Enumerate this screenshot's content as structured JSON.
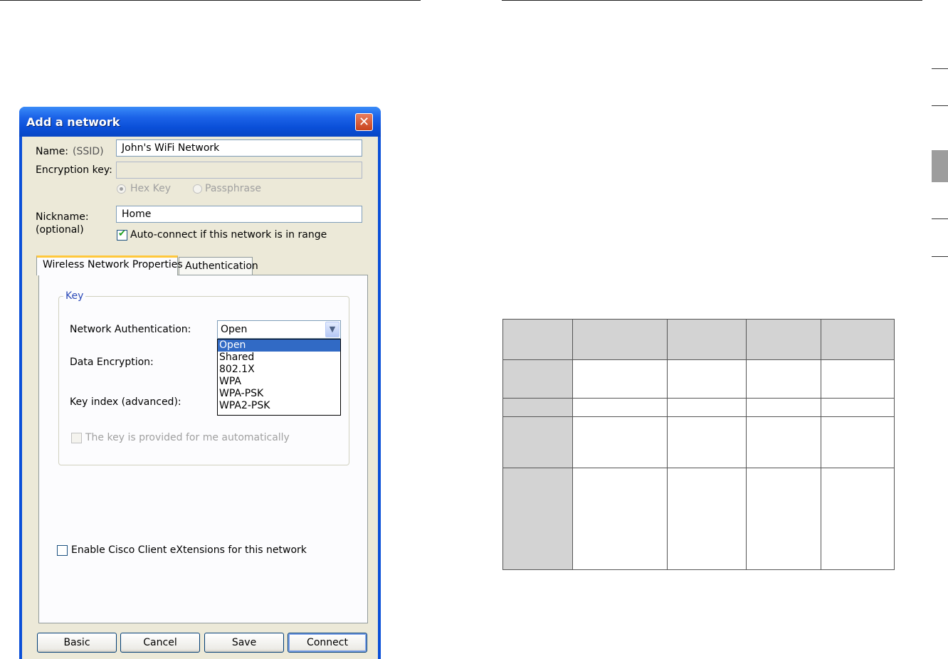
{
  "dialog": {
    "title": "Add a network",
    "close_glyph": "✕",
    "name_label": "Name:",
    "ssid_label": "(SSID)",
    "name_value": "John's WiFi Network",
    "encryption_key_label": "Encryption key:",
    "encryption_key_value": "",
    "hex_key_label": "Hex Key",
    "passphrase_label": "Passphrase",
    "nickname_label": "Nickname:",
    "optional_label": "(optional)",
    "nickname_value": "Home",
    "autoconnect_label": "Auto-connect if this network is in range",
    "autoconnect_checked": true,
    "tabs": [
      {
        "label": "Wireless Network Properties",
        "active": true
      },
      {
        "label": "Authentication",
        "active": false
      }
    ],
    "key_group": {
      "title": "Key",
      "network_auth_label": "Network Authentication:",
      "network_auth_value": "Open",
      "network_auth_options": [
        "Open",
        "Shared",
        "802.1X",
        "WPA",
        "WPA-PSK",
        "WPA2-PSK"
      ],
      "data_encryption_label": "Data Encryption:",
      "key_index_label": "Key index (advanced):",
      "auto_key_label": "The key is provided for me automatically"
    },
    "cisco_label": "Enable Cisco Client eXtensions for this network",
    "buttons": {
      "basic": "Basic",
      "cancel": "Cancel",
      "save": "Save",
      "connect": "Connect"
    },
    "colors": {
      "titlebar": "#0a4fd8",
      "client_bg": "#ece9d8",
      "selection": "#316ac5",
      "close": "#c8421d"
    }
  },
  "page_table": {
    "columns": 5,
    "rows": 5
  }
}
